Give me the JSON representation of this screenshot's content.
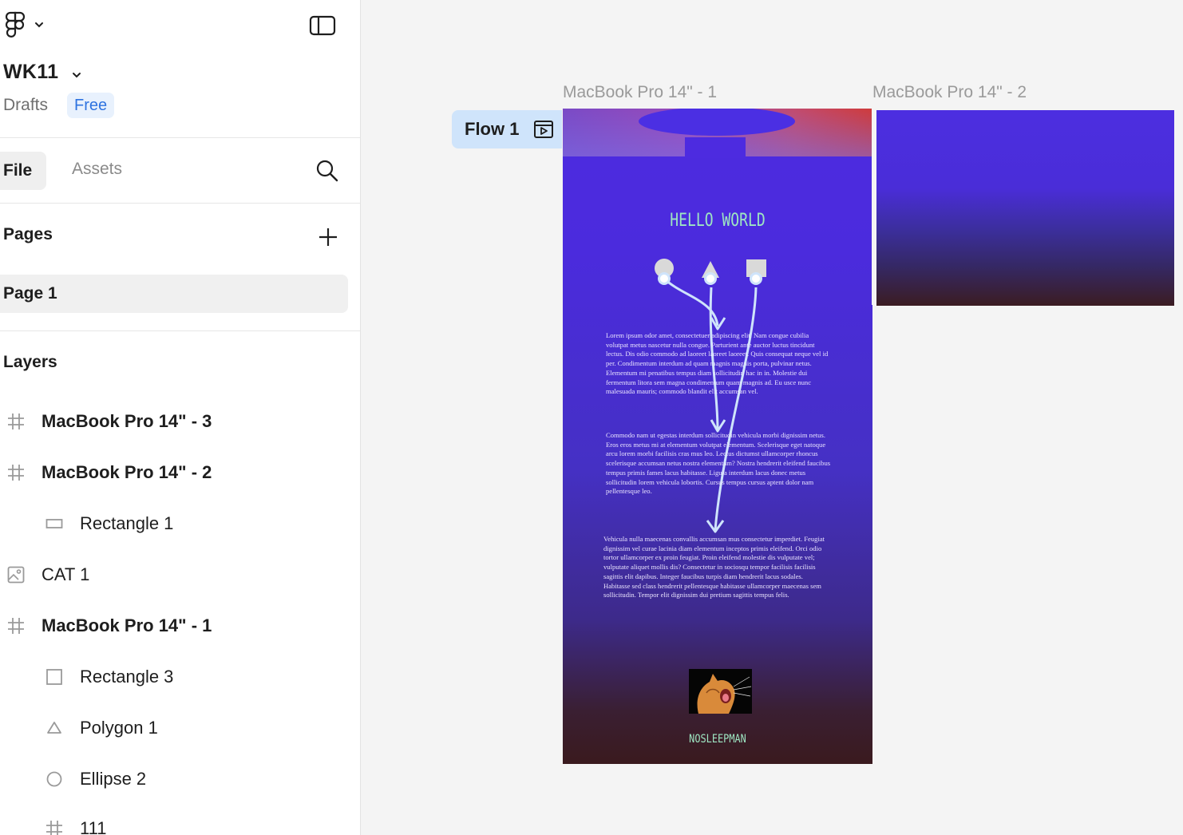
{
  "app": {
    "file_name": "WK11",
    "location": "Drafts",
    "plan_badge": "Free"
  },
  "tabs": {
    "file": "File",
    "assets": "Assets"
  },
  "pages": {
    "title": "Pages",
    "items": [
      "Page 1"
    ]
  },
  "layers": {
    "title": "Layers",
    "items": [
      {
        "name": "MacBook Pro 14\" - 3",
        "icon": "frame-icon",
        "frame": true
      },
      {
        "name": "MacBook Pro 14\" - 2",
        "icon": "frame-icon",
        "frame": true
      },
      {
        "name": "Rectangle 1",
        "icon": "rectangle-icon",
        "frame": false
      },
      {
        "name": "CAT 1",
        "icon": "image-icon",
        "frame": false
      },
      {
        "name": "MacBook Pro 14\" - 1",
        "icon": "frame-icon",
        "frame": true
      },
      {
        "name": "Rectangle 3",
        "icon": "square-icon",
        "frame": false
      },
      {
        "name": "Polygon 1",
        "icon": "triangle-icon",
        "frame": false
      },
      {
        "name": "Ellipse 2",
        "icon": "ellipse-icon",
        "frame": false
      },
      {
        "name": "111",
        "icon": "frame-icon",
        "frame": false
      }
    ]
  },
  "canvas": {
    "flow_label": "Flow 1",
    "frame1_label": "MacBook Pro 14\" - 1",
    "frame2_label": "MacBook Pro 14\" - 2",
    "hello_text": "HELLO WORLD",
    "footer_text": "NOSLEEPMAN",
    "paragraphs": [
      "Lorem ipsum odor amet, consectetuer adipiscing elit. Nam congue cubilia volutpat metus nascetur nulla congue. Parturient ante auctor luctus tincidunt lectus. Dis odio commodo ad laoreet laoreet laoreet. Quis consequat neque vel id per. Condimentum interdum ad quam magnis magnis porta, pulvinar netus. Elementum mi penatibus tempus diam sollicitudin hac in in. Molestie dui fermentum litora sem magna condimentum quam magnis ad. Eu usce nunc malesuada mauris; commodo blandit elit accumsan vel.",
      "Commodo nam ut egestas interdum sollicitudin vehicula morbi dignissim netus. Eros eros metus mi at elementum volutpat elementum. Scelerisque eget natoque arcu lorem morbi facilisis cras mus leo. Lectus dictumst ullamcorper rhoncus scelerisque accumsan netus nostra elementum? Nostra hendrerit eleifend faucibus tempus primis fames lacus habitasse. Ligula interdum lacus donec metus sollicitudin lorem vehicula lobortis. Cursus tempus cursus aptent dolor nam pellentesque leo.",
      "Vehicula nulla maecenas convallis accumsan mus consectetur imperdiet. Feugiat dignissim vel curae lacinia diam elementum inceptos primis eleifend. Orci odio tortor ullamcorper ex proin feugiat. Proin eleifend molestie dis vulputate vel; vulputate aliquet mollis dis? Consectetur in sociosqu tempor facilisis facilisis sagittis elit dapibus. Integer faucibus turpis diam hendrerit lacus sodales. Habitasse sed class hendrerit pellentesque habitasse ullamcorper maecenas sem sollicitudin. Tempor elit dignissim dui pretium sagittis tempus felis."
    ]
  },
  "colors": {
    "accent_blue": "#2e73e0",
    "flow_chip": "#cfe4fb",
    "frame_purple": "#4d2be0",
    "mint_text": "#9ee6c2"
  }
}
